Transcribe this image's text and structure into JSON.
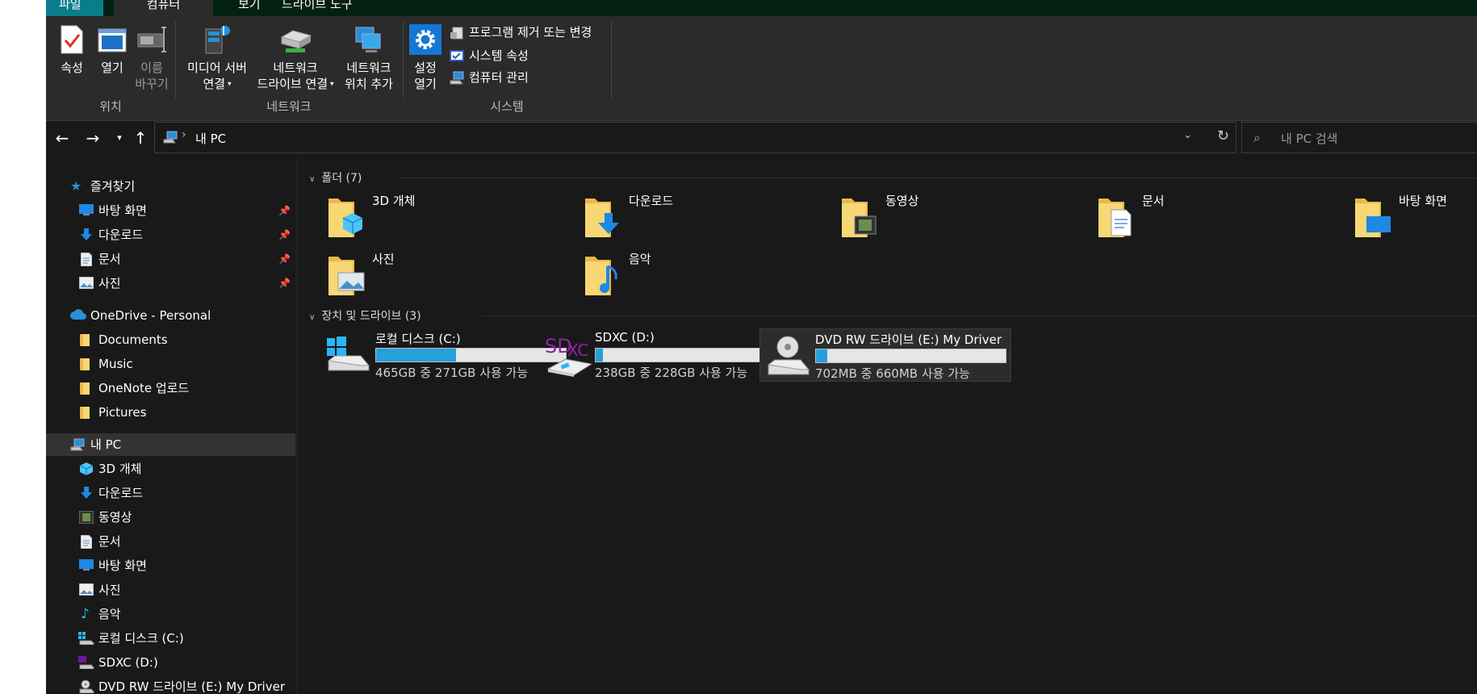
{
  "tabs": {
    "file": "파일",
    "computer": "컴퓨터",
    "view": "보기",
    "drive_tools": "드라이브 도구"
  },
  "ribbon": {
    "properties": "속성",
    "open": "열기",
    "rename_1": "이름",
    "rename_2": "바꾸기",
    "media_1": "미디어 서버",
    "media_2": "연결",
    "netdrive_1": "네트워크",
    "netdrive_2": "드라이브 연결",
    "netloc_1": "네트워크",
    "netloc_2": "위치 추가",
    "settings_1": "설정",
    "settings_2": "열기",
    "uninstall": "프로그램 제거 또는 변경",
    "sysprops": "시스템 속성",
    "manage": "컴퓨터 관리",
    "group_location": "위치",
    "group_network": "네트워크",
    "group_system": "시스템"
  },
  "address": {
    "path": "내 PC",
    "search_placeholder": "내 PC 검색"
  },
  "nav": {
    "quick": "즐겨찾기",
    "quick_items": [
      "바탕 화면",
      "다운로드",
      "문서",
      "사진"
    ],
    "onedrive": "OneDrive - Personal",
    "onedrive_items": [
      "Documents",
      "Music",
      "OneNote 업로드",
      "Pictures"
    ],
    "thispc": "내 PC",
    "pc_items": [
      "3D 개체",
      "다운로드",
      "동영상",
      "문서",
      "바탕 화면",
      "사진",
      "음악",
      "로컬 디스크 (C:)",
      "SDXC (D:)",
      "DVD RW 드라이브 (E:) My Driver"
    ]
  },
  "content": {
    "folders_header": "폴더 (7)",
    "folders": [
      "3D 개체",
      "다운로드",
      "동영상",
      "문서",
      "바탕 화면",
      "사진",
      "음악"
    ],
    "drives_header": "장치 및 드라이브 (3)",
    "drives": [
      {
        "name": "로컬 디스크 (C:)",
        "cap": "465GB 중 271GB 사용 가능",
        "used": 0.42
      },
      {
        "name": "SDXC (D:)",
        "cap": "238GB 중 228GB 사용 가능",
        "used": 0.04
      },
      {
        "name": "DVD RW 드라이브 (E:) My Driver",
        "cap": "702MB 중 660MB 사용 가능",
        "used": 0.06
      }
    ],
    "sdxc_logo_1": "SD",
    "sdxc_logo_2": "XC"
  },
  "colors": {
    "accent": "#26a0da",
    "folder": "#f8d775",
    "folder_dark": "#e9b949",
    "ribbon": "#2b2b2b",
    "window": "#191919"
  }
}
